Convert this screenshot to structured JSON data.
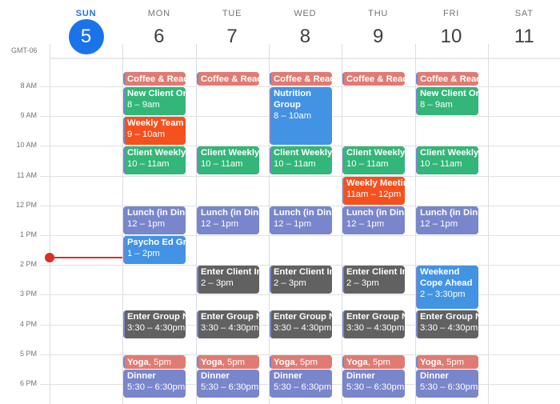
{
  "timezone_label": "GMT-06",
  "days": [
    {
      "dow": "SUN",
      "date": "5",
      "today": true
    },
    {
      "dow": "MON",
      "date": "6",
      "today": false
    },
    {
      "dow": "TUE",
      "date": "7",
      "today": false
    },
    {
      "dow": "WED",
      "date": "8",
      "today": false
    },
    {
      "dow": "THU",
      "date": "9",
      "today": false
    },
    {
      "dow": "FRI",
      "date": "10",
      "today": false
    },
    {
      "dow": "SAT",
      "date": "11",
      "today": false
    }
  ],
  "hour_labels": [
    "8 AM",
    "9 AM",
    "10 AM",
    "11 AM",
    "12 PM",
    "1 PM",
    "2 PM",
    "3 PM",
    "4 PM",
    "5 PM",
    "6 PM"
  ],
  "colors": {
    "today_accent": "#1a73e8",
    "now_indicator": "#d93025",
    "coffee_yoga": "#e07b73",
    "green": "#33b679",
    "tomato": "#f4511e",
    "lavender": "#7986cb",
    "blue": "#4293e3",
    "graphite": "#616161"
  },
  "now_time": 13.75,
  "events": [
    {
      "day": 1,
      "title": "Coffee & Read",
      "time": "",
      "start": 7.5,
      "end": 8.0,
      "color": "coffee",
      "single": true
    },
    {
      "day": 2,
      "title": "Coffee & Read",
      "time": "",
      "start": 7.5,
      "end": 8.0,
      "color": "coffee",
      "single": true
    },
    {
      "day": 3,
      "title": "Coffee & Read",
      "time": "",
      "start": 7.5,
      "end": 8.0,
      "color": "coffee",
      "single": true
    },
    {
      "day": 4,
      "title": "Coffee & Read",
      "time": "",
      "start": 7.5,
      "end": 8.0,
      "color": "coffee",
      "single": true
    },
    {
      "day": 5,
      "title": "Coffee & Read",
      "time": "",
      "start": 7.5,
      "end": 8.0,
      "color": "coffee",
      "single": true
    },
    {
      "day": 1,
      "title": "New Client Orientation",
      "time": "8 – 9am",
      "start": 8,
      "end": 9,
      "color": "green"
    },
    {
      "day": 5,
      "title": "New Client Orientation",
      "time": "8 – 9am",
      "start": 8,
      "end": 9,
      "color": "green"
    },
    {
      "day": 3,
      "title": "Nutrition Group",
      "time": "8 – 10am",
      "start": 8,
      "end": 10,
      "color": "blue",
      "wrap": true
    },
    {
      "day": 1,
      "title": "Weekly Team Meeting",
      "time": "9 – 10am",
      "start": 9,
      "end": 10,
      "color": "tomato"
    },
    {
      "day": 1,
      "title": "Client Weekly Check-in",
      "time": "10 – 11am",
      "start": 10,
      "end": 11,
      "color": "green"
    },
    {
      "day": 2,
      "title": "Client Weekly Check-in",
      "time": "10 – 11am",
      "start": 10,
      "end": 11,
      "color": "green"
    },
    {
      "day": 3,
      "title": "Client Weekly Check-in",
      "time": "10 – 11am",
      "start": 10,
      "end": 11,
      "color": "green"
    },
    {
      "day": 4,
      "title": "Client Weekly Check-in",
      "time": "10 – 11am",
      "start": 10,
      "end": 11,
      "color": "green"
    },
    {
      "day": 5,
      "title": "Client Weekly Check-in",
      "time": "10 – 11am",
      "start": 10,
      "end": 11,
      "color": "green"
    },
    {
      "day": 4,
      "title": "Weekly Meeting",
      "time": "11am – 12pm",
      "start": 11,
      "end": 12,
      "color": "tomato"
    },
    {
      "day": 1,
      "title": "Lunch (in Dining Hall)",
      "time": "12 – 1pm",
      "start": 12,
      "end": 13,
      "color": "lavender"
    },
    {
      "day": 2,
      "title": "Lunch (in Dining Hall)",
      "time": "12 – 1pm",
      "start": 12,
      "end": 13,
      "color": "lavender"
    },
    {
      "day": 3,
      "title": "Lunch (in Dining Hall)",
      "time": "12 – 1pm",
      "start": 12,
      "end": 13,
      "color": "lavender"
    },
    {
      "day": 4,
      "title": "Lunch (in Dining Hall)",
      "time": "12 – 1pm",
      "start": 12,
      "end": 13,
      "color": "lavender"
    },
    {
      "day": 5,
      "title": "Lunch (in Dining Hall)",
      "time": "12 – 1pm",
      "start": 12,
      "end": 13,
      "color": "lavender"
    },
    {
      "day": 1,
      "title": "Psycho Ed Group",
      "time": "1 – 2pm",
      "start": 13,
      "end": 14,
      "color": "blue"
    },
    {
      "day": 2,
      "title": "Enter Client Individual Notes",
      "time": "2 – 3pm",
      "start": 14,
      "end": 15,
      "color": "graphite"
    },
    {
      "day": 3,
      "title": "Enter Client Individual Notes",
      "time": "2 – 3pm",
      "start": 14,
      "end": 15,
      "color": "graphite"
    },
    {
      "day": 4,
      "title": "Enter Client Individual Notes",
      "time": "2 – 3pm",
      "start": 14,
      "end": 15,
      "color": "graphite"
    },
    {
      "day": 5,
      "title": "Weekend Cope Ahead",
      "time": "2 – 3:30pm",
      "start": 14,
      "end": 15.5,
      "color": "blue",
      "wrap": true
    },
    {
      "day": 1,
      "title": "Enter Group Notes",
      "time": "3:30 – 4:30pm",
      "start": 15.5,
      "end": 16.5,
      "color": "graphite"
    },
    {
      "day": 2,
      "title": "Enter Group Notes",
      "time": "3:30 – 4:30pm",
      "start": 15.5,
      "end": 16.5,
      "color": "graphite"
    },
    {
      "day": 3,
      "title": "Enter Group Notes",
      "time": "3:30 – 4:30pm",
      "start": 15.5,
      "end": 16.5,
      "color": "graphite"
    },
    {
      "day": 4,
      "title": "Enter Group Notes",
      "time": "3:30 – 4:30pm",
      "start": 15.5,
      "end": 16.5,
      "color": "graphite"
    },
    {
      "day": 5,
      "title": "Enter Group Notes",
      "time": "3:30 – 4:30pm",
      "start": 15.5,
      "end": 16.5,
      "color": "graphite"
    },
    {
      "day": 1,
      "title": "Yoga",
      "time": "5pm",
      "start": 17,
      "end": 17.5,
      "color": "coffee",
      "single": true
    },
    {
      "day": 2,
      "title": "Yoga",
      "time": "5pm",
      "start": 17,
      "end": 17.5,
      "color": "coffee",
      "single": true
    },
    {
      "day": 3,
      "title": "Yoga",
      "time": "5pm",
      "start": 17,
      "end": 17.5,
      "color": "coffee",
      "single": true
    },
    {
      "day": 4,
      "title": "Yoga",
      "time": "5pm",
      "start": 17,
      "end": 17.5,
      "color": "coffee",
      "single": true
    },
    {
      "day": 5,
      "title": "Yoga",
      "time": "5pm",
      "start": 17,
      "end": 17.5,
      "color": "coffee",
      "single": true
    },
    {
      "day": 1,
      "title": "Dinner",
      "time": "5:30 – 6:30pm",
      "start": 17.5,
      "end": 18.5,
      "color": "lavender"
    },
    {
      "day": 2,
      "title": "Dinner",
      "time": "5:30 – 6:30pm",
      "start": 17.5,
      "end": 18.5,
      "color": "lavender"
    },
    {
      "day": 3,
      "title": "Dinner",
      "time": "5:30 – 6:30pm",
      "start": 17.5,
      "end": 18.5,
      "color": "lavender"
    },
    {
      "day": 4,
      "title": "Dinner",
      "time": "5:30 – 6:30pm",
      "start": 17.5,
      "end": 18.5,
      "color": "lavender"
    },
    {
      "day": 5,
      "title": "Dinner",
      "time": "5:30 – 6:30pm",
      "start": 17.5,
      "end": 18.5,
      "color": "lavender"
    }
  ]
}
